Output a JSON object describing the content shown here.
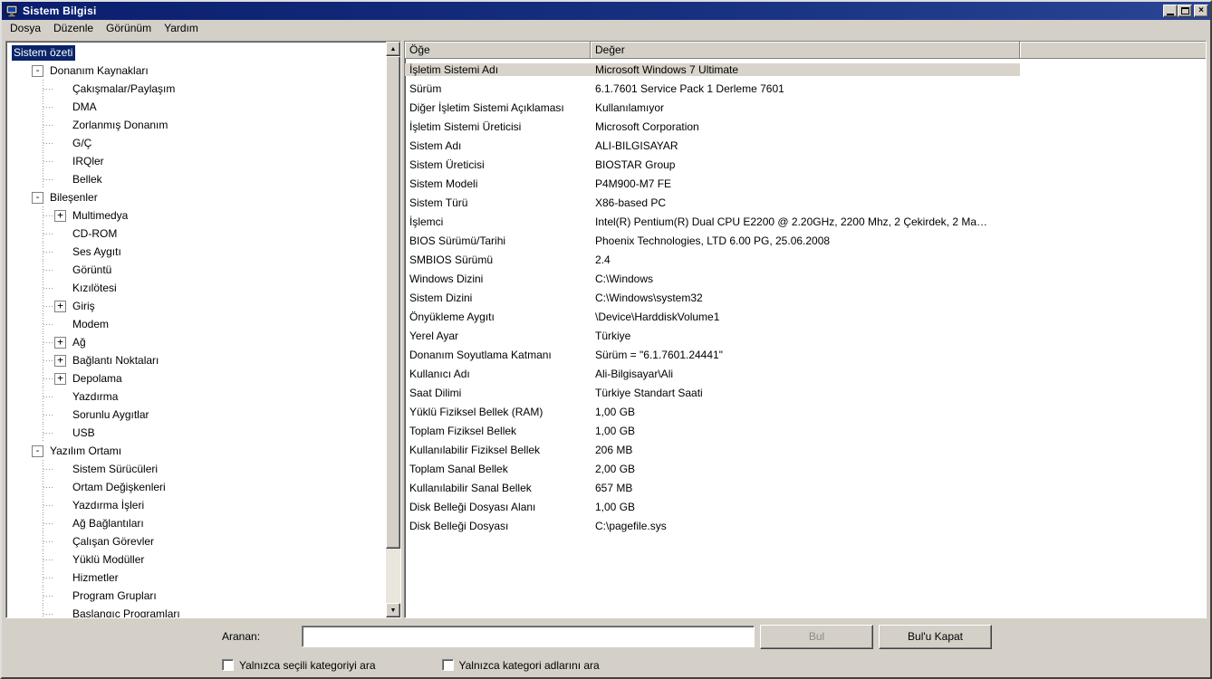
{
  "window": {
    "title": "Sistem Bilgisi"
  },
  "menu": {
    "items": [
      "Dosya",
      "Düzenle",
      "Görünüm",
      "Yardım"
    ]
  },
  "tree": {
    "root": "Sistem özeti",
    "items": [
      {
        "label": "Donanım Kaynakları",
        "level": 1,
        "expander": "minus"
      },
      {
        "label": "Çakışmalar/Paylaşım",
        "level": 2,
        "expander": "none"
      },
      {
        "label": "DMA",
        "level": 2,
        "expander": "none"
      },
      {
        "label": "Zorlanmış Donanım",
        "level": 2,
        "expander": "none"
      },
      {
        "label": "G/Ç",
        "level": 2,
        "expander": "none"
      },
      {
        "label": "IRQler",
        "level": 2,
        "expander": "none"
      },
      {
        "label": "Bellek",
        "level": 2,
        "expander": "none"
      },
      {
        "label": "Bileşenler",
        "level": 1,
        "expander": "minus"
      },
      {
        "label": "Multimedya",
        "level": 2,
        "expander": "plus"
      },
      {
        "label": "CD-ROM",
        "level": 2,
        "expander": "none"
      },
      {
        "label": "Ses Aygıtı",
        "level": 2,
        "expander": "none"
      },
      {
        "label": "Görüntü",
        "level": 2,
        "expander": "none"
      },
      {
        "label": "Kızılötesi",
        "level": 2,
        "expander": "none"
      },
      {
        "label": "Giriş",
        "level": 2,
        "expander": "plus"
      },
      {
        "label": "Modem",
        "level": 2,
        "expander": "none"
      },
      {
        "label": "Ağ",
        "level": 2,
        "expander": "plus"
      },
      {
        "label": "Bağlantı Noktaları",
        "level": 2,
        "expander": "plus"
      },
      {
        "label": "Depolama",
        "level": 2,
        "expander": "plus"
      },
      {
        "label": "Yazdırma",
        "level": 2,
        "expander": "none"
      },
      {
        "label": "Sorunlu Aygıtlar",
        "level": 2,
        "expander": "none"
      },
      {
        "label": "USB",
        "level": 2,
        "expander": "none"
      },
      {
        "label": "Yazılım Ortamı",
        "level": 1,
        "expander": "minus"
      },
      {
        "label": "Sistem Sürücüleri",
        "level": 2,
        "expander": "none"
      },
      {
        "label": "Ortam Değişkenleri",
        "level": 2,
        "expander": "none"
      },
      {
        "label": "Yazdırma İşleri",
        "level": 2,
        "expander": "none"
      },
      {
        "label": "Ağ Bağlantıları",
        "level": 2,
        "expander": "none"
      },
      {
        "label": "Çalışan Görevler",
        "level": 2,
        "expander": "none"
      },
      {
        "label": "Yüklü Modüller",
        "level": 2,
        "expander": "none"
      },
      {
        "label": "Hizmetler",
        "level": 2,
        "expander": "none"
      },
      {
        "label": "Program Grupları",
        "level": 2,
        "expander": "none"
      },
      {
        "label": "Başlangıç Programları",
        "level": 2,
        "expander": "none"
      }
    ]
  },
  "table": {
    "columns": [
      "Öğe",
      "Değer"
    ],
    "selected_row": 0,
    "rows": [
      [
        "İşletim Sistemi Adı",
        "Microsoft Windows 7 Ultimate"
      ],
      [
        "Sürüm",
        "6.1.7601 Service Pack 1 Derleme 7601"
      ],
      [
        "Diğer İşletim Sistemi Açıklaması",
        "Kullanılamıyor"
      ],
      [
        "İşletim Sistemi Üreticisi",
        "Microsoft Corporation"
      ],
      [
        "Sistem Adı",
        "ALI-BILGISAYAR"
      ],
      [
        "Sistem Üreticisi",
        "BIOSTAR Group"
      ],
      [
        "Sistem Modeli",
        "P4M900-M7 FE"
      ],
      [
        "Sistem Türü",
        "X86-based PC"
      ],
      [
        "İşlemci",
        "Intel(R) Pentium(R) Dual  CPU  E2200  @ 2.20GHz, 2200 Mhz, 2 Çekirdek, 2 Ma…"
      ],
      [
        "BIOS Sürümü/Tarihi",
        "Phoenix Technologies, LTD 6.00 PG, 25.06.2008"
      ],
      [
        "SMBIOS Sürümü",
        "2.4"
      ],
      [
        "Windows Dizini",
        "C:\\Windows"
      ],
      [
        "Sistem Dizini",
        "C:\\Windows\\system32"
      ],
      [
        "Önyükleme Aygıtı",
        "\\Device\\HarddiskVolume1"
      ],
      [
        "Yerel Ayar",
        "Türkiye"
      ],
      [
        "Donanım Soyutlama Katmanı",
        "Sürüm = \"6.1.7601.24441\""
      ],
      [
        "Kullanıcı Adı",
        "Ali-Bilgisayar\\Ali"
      ],
      [
        "Saat Dilimi",
        "Türkiye Standart Saati"
      ],
      [
        "Yüklü Fiziksel Bellek (RAM)",
        "1,00 GB"
      ],
      [
        "Toplam Fiziksel Bellek",
        "1,00 GB"
      ],
      [
        "Kullanılabilir Fiziksel Bellek",
        "206 MB"
      ],
      [
        "Toplam Sanal Bellek",
        "2,00 GB"
      ],
      [
        "Kullanılabilir Sanal Bellek",
        "657 MB"
      ],
      [
        "Disk Belleği Dosyası Alanı",
        "1,00 GB"
      ],
      [
        "Disk Belleği Dosyası",
        "C:\\pagefile.sys"
      ]
    ]
  },
  "search": {
    "label": "Aranan:",
    "value": "",
    "find_button": "Bul",
    "close_button": "Bul'u Kapat",
    "checkbox1_label": "Yalnızca seçili kategoriyi ara",
    "checkbox2_label": "Yalnızca kategori adlarını ara"
  },
  "colors": {
    "titlebar": "#0a1e6e",
    "selection": "#0a246a",
    "chrome": "#d4d0c8",
    "selected_row": "#d8d4cb"
  }
}
